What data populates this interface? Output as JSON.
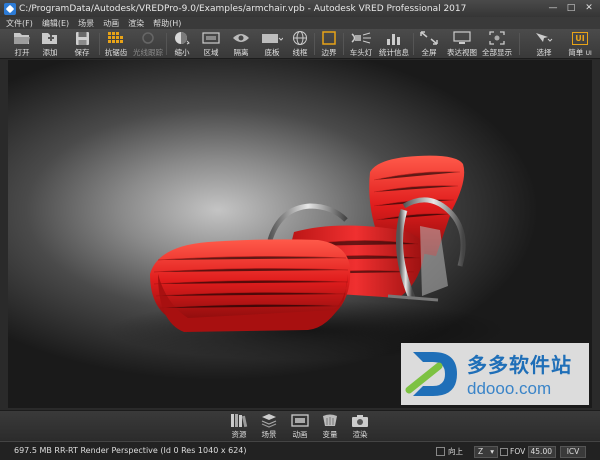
{
  "window": {
    "title": "C:/ProgramData/Autodesk/VREDPro-9.0/Examples/armchair.vpb - Autodesk VRED Professional 2017",
    "controls": {
      "minimize": "—",
      "maximize": "□",
      "close": "✕"
    }
  },
  "menu": [
    "文件(F)",
    "编辑(E)",
    "场景",
    "动画",
    "渲染",
    "帮助(H)"
  ],
  "toolbar": {
    "open": "打开",
    "add": "添加",
    "save": "保存",
    "antialias": "抗锯齿",
    "render_hidden": "光线跟踪",
    "shrink": "缩小",
    "region": "区域",
    "isolate": "隔离",
    "floor": "底板",
    "wireframe": "线框",
    "bounds": "边界",
    "headlight": "车头灯",
    "stats": "统计信息",
    "fullscreen": "全屏",
    "express_view": "表达视图",
    "show_all": "全部显示",
    "select": "选择",
    "simple_ui": "简单",
    "ui_badge": "UI",
    "ui_small": "UI"
  },
  "panels": {
    "assets": "资源",
    "scene": "场景",
    "animation": "动画",
    "variants": "变量",
    "render": "渲染"
  },
  "status": {
    "text": "697.5 MB   RR-RT   Render Perspective (Id 0 Res 1040 x 624)",
    "up_label": "向上",
    "up_axis": "Z",
    "fov_label": "FOV",
    "fov_value": "45.00",
    "icv_label": "ICV"
  },
  "watermark": {
    "logo_letter": "D",
    "name": "多多软件站",
    "url": "ddooo.com"
  },
  "colors": {
    "accent_orange": "#e8a317",
    "chair_red": "#e01d1d",
    "watermark_blue": "#1f6fb8"
  }
}
